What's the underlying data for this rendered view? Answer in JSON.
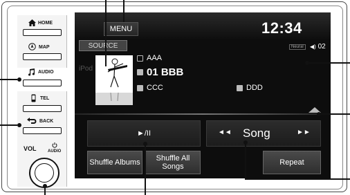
{
  "hardware": {
    "home_label": "HOME",
    "home_icon": "home-icon",
    "map_label": "MAP",
    "map_icon": "map-icon",
    "audio_label": "AUDIO",
    "audio_icon": "music-note-icon",
    "tel_label": "TEL",
    "tel_icon": "phone-icon",
    "back_label": "BACK",
    "back_icon": "back-arrow-icon",
    "vol_label": "VOL",
    "vol_audio_label": "AUDIO",
    "power_icon": "power-icon"
  },
  "screen": {
    "menu_label": "MENU",
    "clock": "12:34",
    "source_label": "SOURCE",
    "ipod_label": "iPod",
    "neural_badge": "Neural",
    "volume_indicator": "02",
    "track": {
      "artist": "AAA",
      "title": "01 BBB",
      "album": "CCC",
      "genre": "DDD"
    },
    "playpause_label": "►/II",
    "song_mode_label": "Song",
    "skip_prev": "◄◄",
    "skip_next": "►►",
    "shuffle_albums_label": "Shuffle Albums",
    "shuffle_all_label": "Shuffle All Songs",
    "repeat_label": "Repeat"
  }
}
